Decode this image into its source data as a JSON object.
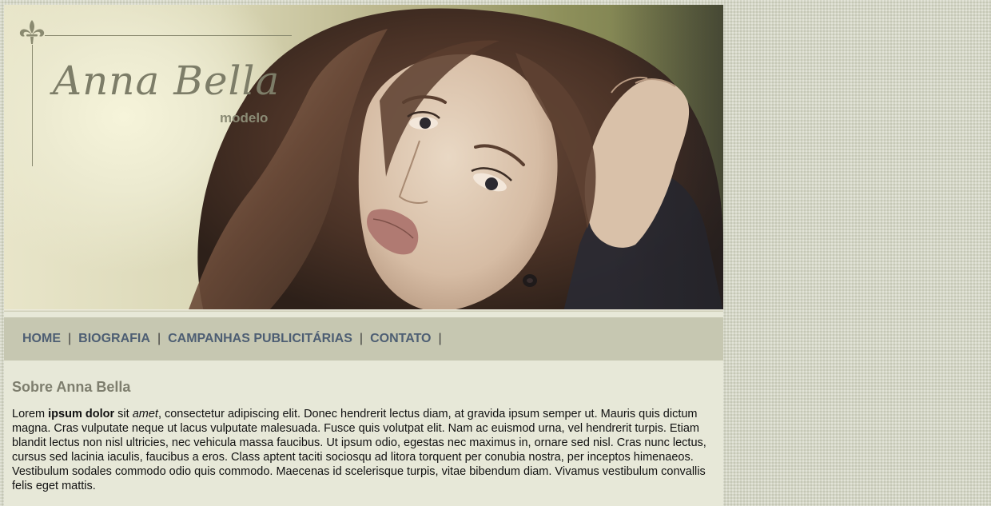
{
  "brand": {
    "name": "Anna Bella",
    "subtitle": "modelo"
  },
  "nav": {
    "items": [
      {
        "label": "HOME"
      },
      {
        "label": "BIOGRAFIA"
      },
      {
        "label": "CAMPANHAS PUBLICITÁRIAS"
      },
      {
        "label": "CONTATO"
      }
    ],
    "separator": "|"
  },
  "content": {
    "heading": "Sobre Anna Bella",
    "paragraph": {
      "t1": "Lorem ",
      "bold": "ipsum dolor",
      "t2": " sit ",
      "italic": "amet",
      "t3": ", consectetur adipiscing elit. Donec hendrerit lectus diam, at gravida ipsum semper ut. Mauris quis dictum magna. Cras vulputate neque ut lacus vulputate malesuada. Fusce quis volutpat elit. Nam ac euismod urna, vel hendrerit turpis. Etiam blandit lectus non nisl ultricies, nec vehicula massa faucibus. Ut ipsum odio, egestas nec maximus in, ornare sed nisl. Cras nunc lectus, cursus sed lacinia iaculis, faucibus a eros. Class aptent taciti sociosqu ad litora torquent per conubia nostra, per inceptos himenaeos. Vestibulum sodales commodo odio quis commodo. Maecenas id scelerisque turpis, vitae bibendum diam. Vivamus vestibulum convallis felis eget mattis."
    }
  },
  "colors": {
    "nav_link": "#4d5e73",
    "nav_bg": "#c6c7b1",
    "content_bg": "#e7e8d8",
    "heading": "#7e7e6e",
    "brand": "#7d7d68"
  },
  "icons": {
    "logo_ornament": "fleur-de-lis-icon"
  }
}
